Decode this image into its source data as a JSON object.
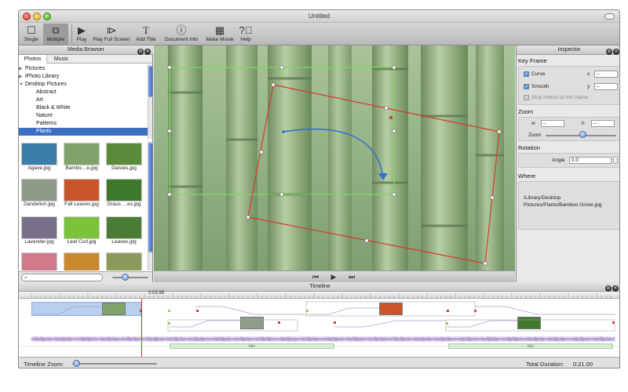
{
  "window": {
    "title": "Untitled"
  },
  "toolbar": {
    "single": "Single",
    "multiple": "Multiple",
    "play": "Play",
    "play_full_screen": "Play Full Screen",
    "add_title": "Add Title",
    "document_info": "Document Info",
    "make_movie": "Make Movie",
    "help": "Help"
  },
  "media_browser": {
    "title": "Media Browser",
    "tabs": [
      "Photos",
      "Music"
    ],
    "tree": [
      {
        "label": "Pictures",
        "expandable": true
      },
      {
        "label": "iPhoto Library",
        "expandable": true
      },
      {
        "label": "Desktop Pictures",
        "expanded": true
      },
      {
        "label": "Abstract"
      },
      {
        "label": "Art"
      },
      {
        "label": "Black & White"
      },
      {
        "label": "Nature"
      },
      {
        "label": "Patterns"
      },
      {
        "label": "Plants",
        "selected": true
      }
    ],
    "thumbnails": [
      {
        "name": "Agave.jpg",
        "color": "#3a7fa8"
      },
      {
        "name": "Bambo…e.jpg",
        "color": "#7fa36b"
      },
      {
        "name": "Daisies.jpg",
        "color": "#5c8a3c"
      },
      {
        "name": "Dandelion.jpg",
        "color": "#8e9b88"
      },
      {
        "name": "Fall Leaves.jpg",
        "color": "#c8552a"
      },
      {
        "name": "Grass …es.jpg",
        "color": "#3f7a2c"
      },
      {
        "name": "Lavender.jpg",
        "color": "#7a6f8a"
      },
      {
        "name": "Leaf Curl.jpg",
        "color": "#7cc23a"
      },
      {
        "name": "Leaves.jpg",
        "color": "#4a7c35"
      },
      {
        "name": "",
        "color": "#d07a8a"
      },
      {
        "name": "",
        "color": "#c9892e"
      },
      {
        "name": "",
        "color": "#8a9a5a"
      }
    ],
    "search_placeholder": ""
  },
  "inspector": {
    "title": "Inspector",
    "key_frame": {
      "heading": "Key Frame",
      "curve": "Curve",
      "smooth": "Smooth",
      "stop_motion": "Stop motion at this frame",
      "x_label": "x",
      "y_label": "y",
      "x_value": "–",
      "y_value": "–"
    },
    "zoom": {
      "heading": "Zoom",
      "w_label": "w",
      "h_label": "h",
      "w_value": "–",
      "h_value": "–",
      "zoom_label": "Zoom",
      "level": 0.55
    },
    "rotation": {
      "heading": "Rotation",
      "angle_label": "Angle",
      "angle_value": "0.0"
    },
    "where": {
      "heading": "Where",
      "path": "/Library/Desktop Pictures/Plants/Bamboo Grove.jpg"
    }
  },
  "timeline": {
    "title": "Timeline",
    "playhead_time": "0:03.99",
    "zoom_label": "Timeline Zoom:",
    "zoom_level": 0.05,
    "total_duration_label": "Total Duration:",
    "total_duration": "0:21.00",
    "title_clip_label": "title"
  },
  "colors": {
    "selection": "#3a6fc2",
    "start_frame": "#7ed957",
    "end_frame": "#d8382b",
    "motion_path": "#2f6fd1",
    "playhead": "#e03030"
  }
}
